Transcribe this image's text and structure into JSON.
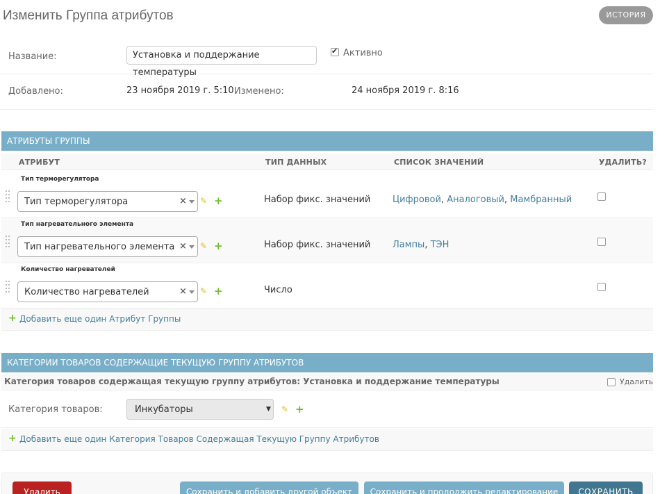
{
  "page": {
    "title": "Изменить Группа атрибутов",
    "history_label": "ИСТОРИЯ"
  },
  "form": {
    "name_label": "Название:",
    "name_value": "Установка и поддержание температуры",
    "active_label": "Активно",
    "active_checked": true,
    "added_label": "Добавлено:",
    "added_value": "23 ноября 2019 г. 5:10",
    "changed_label": "Изменено:",
    "changed_value": "24 ноября 2019 г. 8:16"
  },
  "attributes_module": {
    "heading": "АТРИБУТЫ ГРУППЫ",
    "columns": {
      "attribute": "АТРИБУТ",
      "data_type": "ТИП ДАННЫХ",
      "values_list": "СПИСОК ЗНАЧЕНИЙ",
      "delete": "УДАЛИТЬ?"
    },
    "rows": [
      {
        "label": "Тип терморегулятора",
        "selected": "Тип терморегулятора",
        "data_type": "Набор фикс. значений",
        "values": [
          "Цифровой",
          "Аналоговый",
          "Мамбранный"
        ]
      },
      {
        "label": "Тип нагревательного элемента",
        "selected": "Тип нагревательного элемента",
        "data_type": "Набор фикс. значений",
        "values": [
          "Лампы",
          "ТЭН"
        ]
      },
      {
        "label": "Количество нагревателей",
        "selected": "Количество нагревателей",
        "data_type": "Число",
        "values": []
      }
    ],
    "add_link": "Добавить еще один Атрибут Группы"
  },
  "categories_module": {
    "heading": "КАТЕГОРИИ ТОВАРОВ СОДЕРЖАЩИЕ ТЕКУЩУЮ ГРУППУ АТРИБУТОВ",
    "item_title": "Категория товаров содержащая текущую группу атрибутов: Установка и поддержание температуры",
    "delete_label": "Удалить",
    "category_label": "Категория товаров:",
    "category_value": "Инкубаторы",
    "add_link": "Добавить еще один Категория Товаров Содержащая Текущую Группу Атрибутов"
  },
  "actions": {
    "delete": "Удалить",
    "save_add_another": "Сохранить и добавить другой объект",
    "save_continue": "Сохранить и продолжить редактирование",
    "save": "СОХРАНИТЬ"
  },
  "colors": {
    "module_header": "#79aec8",
    "link": "#447e9b",
    "add_icon": "#70bf2b",
    "edit_icon": "#e0c020",
    "delete_button": "#ba2121",
    "save_button": "#417690"
  },
  "icons": {
    "edit": "pencil-icon",
    "add": "plus-icon",
    "drag": "drag-handle-icon",
    "clear": "clear-x-icon",
    "dropdown": "chevron-down-icon"
  }
}
